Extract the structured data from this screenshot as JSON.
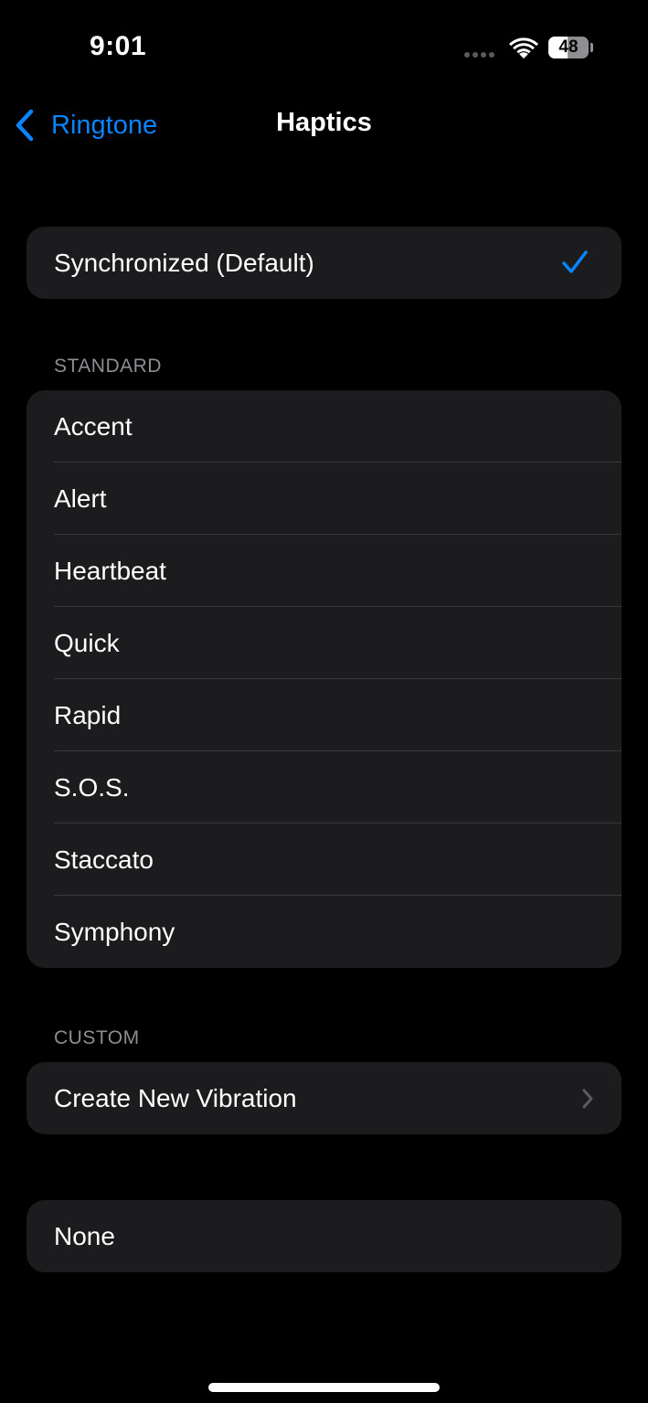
{
  "status_bar": {
    "time": "9:01",
    "battery_percent": "48",
    "battery_level": 0.48,
    "signal_icon": "cellular-signal-icon",
    "wifi_icon": "wifi-icon"
  },
  "nav": {
    "back_label": "Ringtone",
    "back_icon": "chevron-left-icon",
    "title": "Haptics"
  },
  "default_option": {
    "label": "Synchronized (Default)",
    "selected": true,
    "check_icon": "checkmark-icon"
  },
  "standard": {
    "header": "STANDARD",
    "items": [
      {
        "label": "Accent"
      },
      {
        "label": "Alert"
      },
      {
        "label": "Heartbeat"
      },
      {
        "label": "Quick"
      },
      {
        "label": "Rapid"
      },
      {
        "label": "S.O.S."
      },
      {
        "label": "Staccato"
      },
      {
        "label": "Symphony"
      }
    ]
  },
  "custom": {
    "header": "CUSTOM",
    "create_label": "Create New Vibration",
    "chevron_icon": "chevron-right-icon"
  },
  "none_option": {
    "label": "None"
  },
  "colors": {
    "accent": "#0a84ff",
    "background": "#000000",
    "group_background": "#1c1c1e",
    "separator": "#38383a",
    "secondary_text": "#8d8d93"
  }
}
